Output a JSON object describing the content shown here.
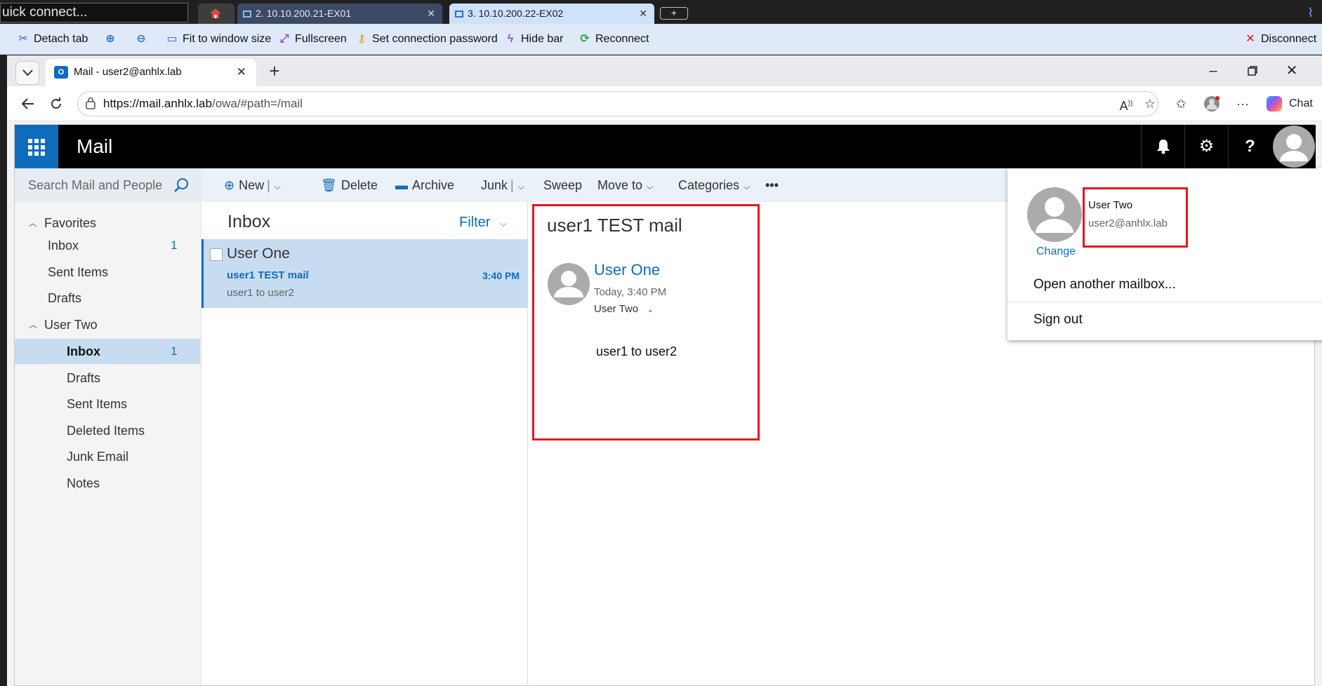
{
  "rdp": {
    "quick_connect": "uick connect...",
    "tabs": [
      {
        "label": "2. 10.10.200.21-EX01"
      },
      {
        "label": "3. 10.10.200.22-EX02"
      }
    ],
    "add_tab": "+",
    "toolbar": {
      "detach": "Detach tab",
      "fit": "Fit to window size",
      "fullscreen": "Fullscreen",
      "password": "Set connection password",
      "hide": "Hide bar",
      "reconnect": "Reconnect",
      "disconnect": "Disconnect"
    }
  },
  "browser": {
    "tab_title": "Mail - user2@anhlx.lab",
    "url_host": "https://mail.anhlx.lab",
    "url_path": "/owa/#path=/mail",
    "chat_label": "Chat"
  },
  "owa": {
    "app_title": "Mail",
    "search_placeholder": "Search Mail and People",
    "commands": {
      "new": "New",
      "delete": "Delete",
      "archive": "Archive",
      "junk": "Junk",
      "sweep": "Sweep",
      "move_to": "Move to",
      "categories": "Categories",
      "more": "•••"
    },
    "favorites": {
      "label": "Favorites",
      "items": [
        {
          "label": "Inbox",
          "count": "1"
        },
        {
          "label": "Sent Items",
          "count": ""
        },
        {
          "label": "Drafts",
          "count": ""
        }
      ]
    },
    "mailbox": {
      "label": "User Two",
      "items": [
        {
          "label": "Inbox",
          "count": "1"
        },
        {
          "label": "Drafts",
          "count": ""
        },
        {
          "label": "Sent Items",
          "count": ""
        },
        {
          "label": "Deleted Items",
          "count": ""
        },
        {
          "label": "Junk Email",
          "count": ""
        },
        {
          "label": "Notes",
          "count": ""
        }
      ]
    },
    "list": {
      "title": "Inbox",
      "filter": "Filter",
      "messages": [
        {
          "from": "User One",
          "subject": "user1 TEST mail",
          "time": "3:40 PM",
          "preview": "user1 to user2"
        }
      ]
    },
    "reading": {
      "subject": "user1 TEST mail",
      "from": "User One",
      "date": "Today, 3:40 PM",
      "to": "User Two",
      "body": "user1 to user2"
    },
    "account": {
      "name": "User Two",
      "email": "user2@anhlx.lab",
      "change": "Change",
      "open_another": "Open another mailbox...",
      "sign_out": "Sign out"
    }
  },
  "colors": {
    "accent": "#0f6cbd",
    "selection": "#c7dcf0",
    "highlight_box": "#e0181e"
  }
}
